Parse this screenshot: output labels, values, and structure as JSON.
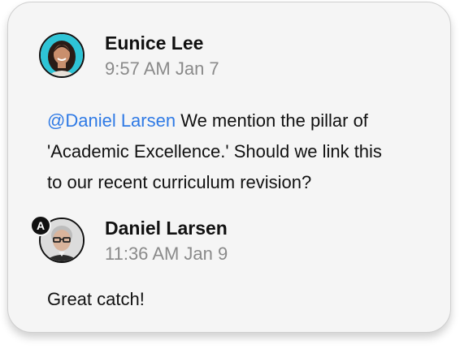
{
  "comments": [
    {
      "author": "Eunice Lee",
      "timestamp": "9:57 AM Jan 7",
      "avatar_icon": "user-avatar-woman",
      "mention": "@Daniel Larsen",
      "lines": [
        " We mention the pillar of",
        "'Academic Excellence.' Should we link this",
        "to our recent curriculum revision?"
      ]
    },
    {
      "author": "Daniel Larsen",
      "timestamp": "11:36 AM Jan 9",
      "avatar_icon": "user-avatar-man",
      "badge": "A",
      "lines": [
        "Great catch!"
      ]
    }
  ],
  "colors": {
    "mention": "#2f7ae5",
    "timestamp": "#8a8a8a",
    "card_bg": "#f5f5f5"
  }
}
